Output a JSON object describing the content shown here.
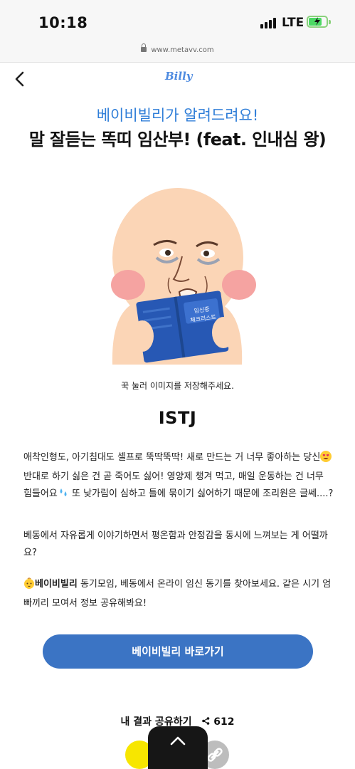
{
  "status_bar": {
    "time": "10:18",
    "network": "LTE",
    "battery_charging": true,
    "battery_color": "#4cd964"
  },
  "browser": {
    "url": "www.metavv.com",
    "lock_icon": "lock-icon"
  },
  "nav": {
    "back_icon": "chevron-left-icon",
    "logo": "Billy"
  },
  "header": {
    "subtitle": "베이비빌리가 알려드려요!",
    "title": "말 잘듣는 똑띠 임산부! (feat. 인내심 왕)"
  },
  "illustration": {
    "booklet_line1": "임신중",
    "booklet_line2": "체크리스트"
  },
  "save_hint": "꾹 눌러 이미지를 저장해주세요.",
  "result": {
    "type": "ISTJ",
    "p1_before_emoji1": "애착인형도, 아기침대도 셀프로 뚝딱뚝딱! 새로 만드는 거 너무 좋아하는 당신",
    "p1_between": " 반대로 하기 싫은 건 곧 죽어도 싫어! 영양제 챙겨 먹고, 매일 운동하는 건 너무 힘들어요",
    "p1_after": " 또 낮가림이 심하고 틀에 묶이기 싫어하기 때문에 조리원은 글쎄....?",
    "p2": "베동에서 자유롭게 이야기하면서 평온함과 안정감을 동시에 느껴보는 게 어떨까요?",
    "p3_brand": "베이비빌리",
    "p3_rest": " 동기모임, 베동에서 온라이 임신 동기를 찾아보세요. 같은 시기 엄빠끼리 모여서 정보 공유해봐요!"
  },
  "cta": {
    "label": "베이비빌리 바로가기",
    "color": "#3b74c4"
  },
  "share": {
    "label": "내 결과 공유하기",
    "count": "612",
    "kakao_color": "#f7e600"
  },
  "scroll_top_icon": "chevron-up-icon"
}
